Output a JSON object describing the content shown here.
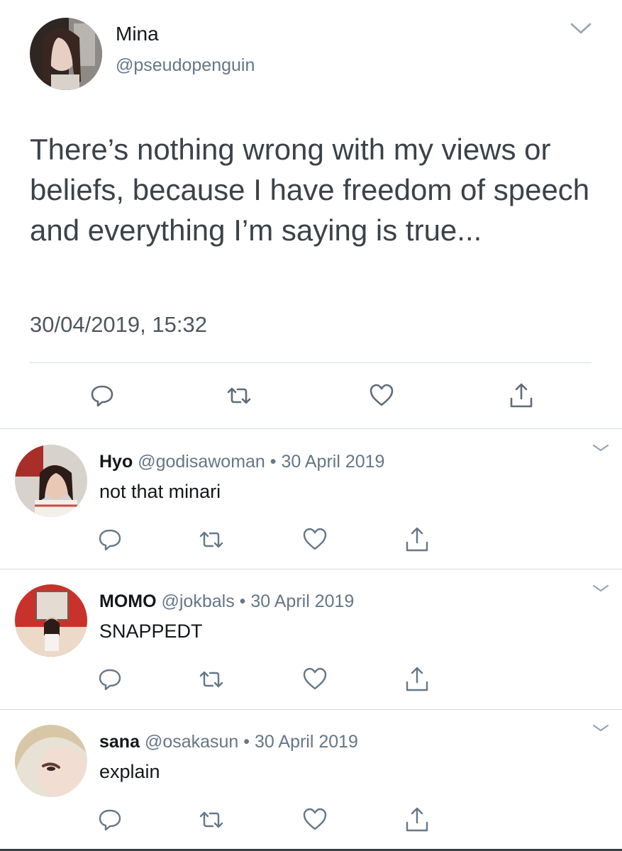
{
  "tweet": {
    "author_name": "Mina",
    "author_handle": "@pseudopenguin",
    "text": "There’s nothing wrong with my views or beliefs, because I have freedom of speech and everything I’m saying is true...",
    "timestamp": "30/04/2019, 15:32",
    "actions": [
      "reply-icon",
      "retweet-icon",
      "like-icon",
      "share-icon"
    ]
  },
  "replies": [
    {
      "name": "Hyo",
      "handle": "@godisawoman",
      "separator": "•",
      "date": "30 April 2019",
      "text": "not that minari"
    },
    {
      "name": "MOMO",
      "handle": "@jokbals",
      "separator": "•",
      "date": "30 April 2019",
      "text": "SNAPPEDT"
    },
    {
      "name": "sana",
      "handle": "@osakasun",
      "separator": "•",
      "date": "30 April 2019",
      "text": "explain"
    }
  ],
  "colors": {
    "text": "#14171a",
    "secondary": "#657786",
    "divider": "#d6dde3"
  }
}
